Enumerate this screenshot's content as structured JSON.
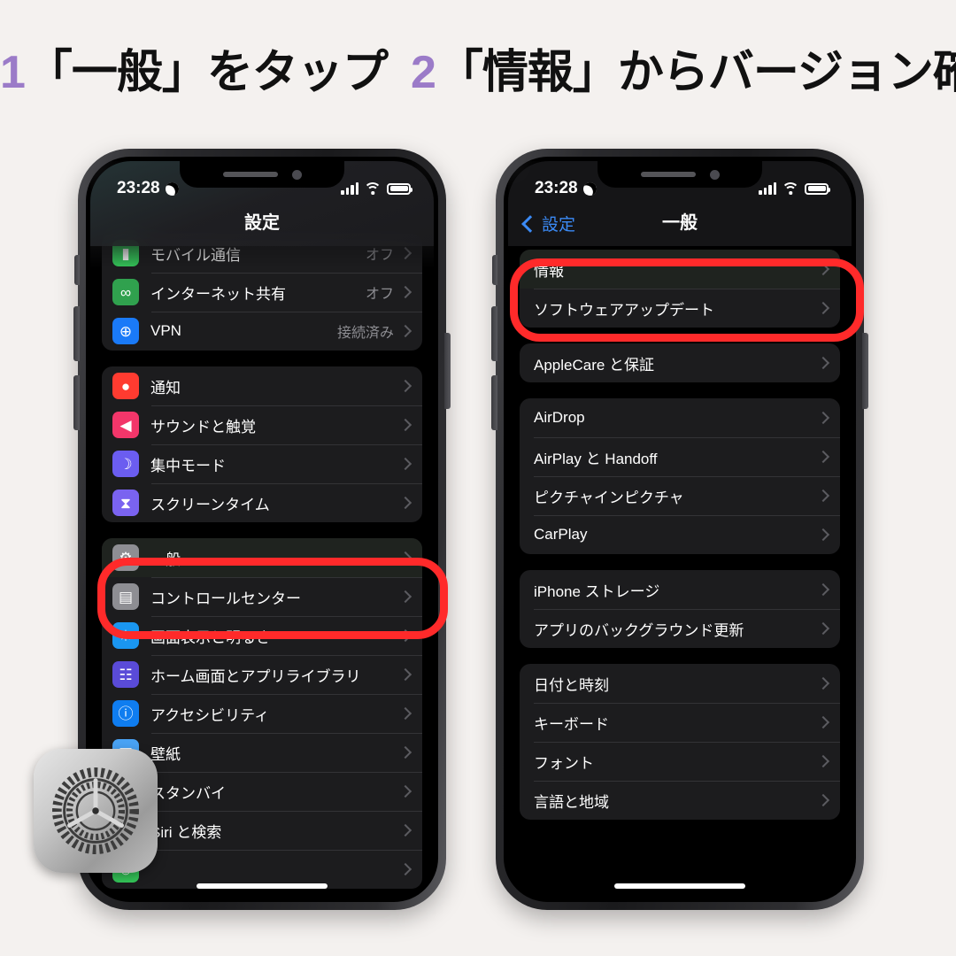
{
  "headline": {
    "step1_num": "1",
    "step1_text": "「一般」をタップ",
    "step2_num": "2",
    "step2_text": "「情報」からバージョン確認"
  },
  "colors": {
    "background": "#f4f1ef",
    "accent_purple": "#9b7bc8",
    "marker_red": "#ff2a2a",
    "link_blue": "#3b8af5",
    "list_bg": "#1c1c1e",
    "screen_bg": "#000000"
  },
  "status_bar": {
    "time": "23:28",
    "moon_icon": "crescent-moon-icon",
    "signal_icon": "cellular-signal-icon",
    "wifi_icon": "wifi-icon",
    "battery_icon": "battery-icon"
  },
  "phone_left": {
    "nav": {
      "title": "設定"
    },
    "groups": [
      {
        "rows": [
          {
            "label": "モバイル通信",
            "value": "オフ",
            "icon": "cellular-icon",
            "icon_color": "#34c759",
            "glyph": "▮",
            "partial": true
          },
          {
            "label": "インターネット共有",
            "value": "オフ",
            "icon": "hotspot-icon",
            "icon_color": "#30a14e",
            "glyph": "∞"
          },
          {
            "label": "VPN",
            "value": "接続済み",
            "icon": "vpn-globe-icon",
            "icon_color": "#1a7af8",
            "glyph": "⊕"
          }
        ]
      },
      {
        "rows": [
          {
            "label": "通知",
            "value": "",
            "icon": "notification-bell-icon",
            "icon_color": "#ff3b30",
            "glyph": "●"
          },
          {
            "label": "サウンドと触覚",
            "value": "",
            "icon": "sound-icon",
            "icon_color": "#f2366a",
            "glyph": "◀"
          },
          {
            "label": "集中モード",
            "value": "",
            "icon": "focus-moon-icon",
            "icon_color": "#6b5df0",
            "glyph": "☽"
          },
          {
            "label": "スクリーンタイム",
            "value": "",
            "icon": "screen-time-icon",
            "icon_color": "#7a63f0",
            "glyph": "⧗"
          }
        ]
      },
      {
        "rows": [
          {
            "label": "一般",
            "value": "",
            "icon": "general-gear-icon",
            "icon_color": "#8e8e93",
            "glyph": "⚙",
            "highlighted": true
          },
          {
            "label": "コントロールセンター",
            "value": "",
            "icon": "control-center-icon",
            "icon_color": "#8e8e93",
            "glyph": "▤"
          },
          {
            "label": "画面表示と明るさ",
            "value": "",
            "icon": "display-brightness-icon",
            "icon_color": "#1a96f0",
            "glyph": "☀"
          },
          {
            "label": "ホーム画面とアプリライブラリ",
            "value": "",
            "icon": "home-screen-icon",
            "icon_color": "#5a4bd8",
            "glyph": "☷"
          },
          {
            "label": "アクセシビリティ",
            "value": "",
            "icon": "accessibility-icon",
            "icon_color": "#0f7df0",
            "glyph": "ⓘ"
          },
          {
            "label": "壁紙",
            "value": "",
            "icon": "wallpaper-icon",
            "icon_color": "#49a3f5",
            "glyph": "◰"
          },
          {
            "label": "スタンバイ",
            "value": "",
            "icon": "standby-icon",
            "icon_color": "#2a2a2e",
            "glyph": "□"
          },
          {
            "label": "Siri と検索",
            "value": "",
            "icon": "siri-icon",
            "icon_color": "#2a2a2e",
            "glyph": "◎"
          },
          {
            "label": "",
            "value": "",
            "icon": "face-id-icon",
            "icon_color": "#34c759",
            "glyph": "☺"
          }
        ]
      }
    ]
  },
  "phone_right": {
    "nav": {
      "back_label": "設定",
      "title": "一般"
    },
    "groups": [
      {
        "rows": [
          {
            "label": "情報",
            "value": "",
            "highlighted": true
          },
          {
            "label": "ソフトウェアアップデート",
            "value": ""
          }
        ]
      },
      {
        "rows": [
          {
            "label": "AppleCare と保証",
            "value": ""
          }
        ]
      },
      {
        "rows": [
          {
            "label": "AirDrop",
            "value": ""
          },
          {
            "label": "AirPlay と Handoff",
            "value": ""
          },
          {
            "label": "ピクチャインピクチャ",
            "value": ""
          },
          {
            "label": "CarPlay",
            "value": ""
          }
        ]
      },
      {
        "rows": [
          {
            "label": "iPhone ストレージ",
            "value": ""
          },
          {
            "label": "アプリのバックグラウンド更新",
            "value": ""
          }
        ]
      },
      {
        "rows": [
          {
            "label": "日付と時刻",
            "value": ""
          },
          {
            "label": "キーボード",
            "value": ""
          },
          {
            "label": "フォント",
            "value": ""
          },
          {
            "label": "言語と地域",
            "value": ""
          }
        ]
      }
    ]
  },
  "overlay_icon": {
    "name": "settings-app-icon",
    "label": "設定"
  }
}
